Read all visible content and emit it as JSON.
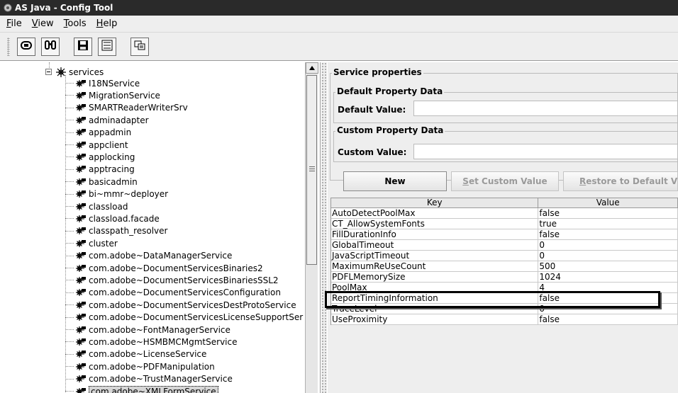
{
  "window": {
    "title": "AS Java - Config Tool"
  },
  "menu": {
    "items": [
      "File",
      "View",
      "Tools",
      "Help"
    ]
  },
  "toolbar": {
    "buttons": [
      "connect-icon",
      "find-icon",
      "save-icon",
      "xml-icon",
      "compare-icon"
    ]
  },
  "tree": {
    "parent": "services",
    "items": [
      "I18NService",
      "MigrationService",
      "SMARTReaderWriterSrv",
      "adminadapter",
      "appadmin",
      "appclient",
      "applocking",
      "apptracing",
      "basicadmin",
      "bi~mmr~deployer",
      "classload",
      "classload.facade",
      "classpath_resolver",
      "cluster",
      "com.adobe~DataManagerService",
      "com.adobe~DocumentServicesBinaries2",
      "com.adobe~DocumentServicesBinariesSSL2",
      "com.adobe~DocumentServicesConfiguration",
      "com.adobe~DocumentServicesDestProtoService",
      "com.adobe~DocumentServicesLicenseSupportSer",
      "com.adobe~FontManagerService",
      "com.adobe~HSMBMCMgmtService",
      "com.adobe~LicenseService",
      "com.adobe~PDFManipulation",
      "com.adobe~TrustManagerService",
      "com.adobe~XMLFormService"
    ],
    "selected_index": 25
  },
  "service_properties": {
    "title": "Service properties",
    "default_group": "Default Property Data",
    "default_label": "Default Value:",
    "default_value": "",
    "custom_group": "Custom Property Data",
    "custom_label": "Custom Value:",
    "custom_value": ""
  },
  "buttons": {
    "new": "New",
    "set_custom": "Set Custom Value",
    "restore": "Restore to Default Valu"
  },
  "table": {
    "headers": [
      "Key",
      "Value"
    ],
    "rows": [
      [
        "AutoDetectPoolMax",
        "false"
      ],
      [
        "CT_AllowSystemFonts",
        "true"
      ],
      [
        "FillDurationInfo",
        "false"
      ],
      [
        "GlobalTimeout",
        "0"
      ],
      [
        "JavaScriptTimeout",
        "0"
      ],
      [
        "MaximumReUseCount",
        "500"
      ],
      [
        "PDFLMemorySize",
        "1024"
      ],
      [
        "PoolMax",
        "4"
      ],
      [
        "ReportTimingInformation",
        "false"
      ],
      [
        "TraceLevel",
        "0"
      ],
      [
        "UseProximity",
        "false"
      ]
    ],
    "highlighted_row": 7
  }
}
